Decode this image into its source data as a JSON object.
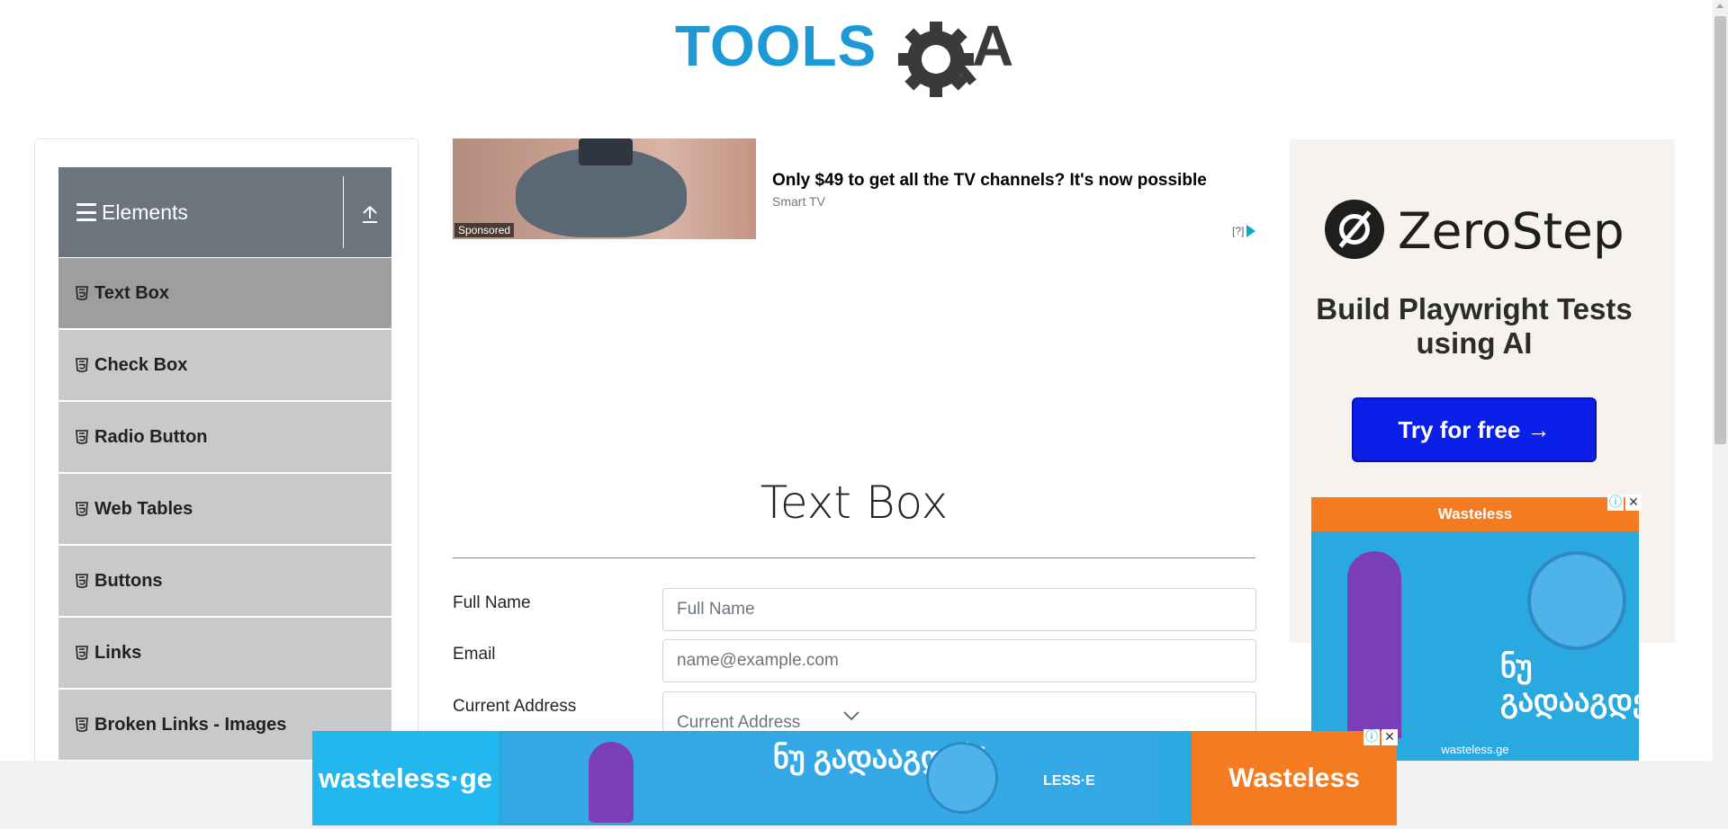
{
  "header": {
    "logo_text": "TOOLSQA",
    "logo_colors": {
      "tools": "#1b9ad6",
      "qa": "#3a3a3a"
    }
  },
  "sidebar": {
    "group_title": "Elements",
    "items": [
      {
        "label": "Text Box",
        "active": true
      },
      {
        "label": "Check Box",
        "active": false
      },
      {
        "label": "Radio Button",
        "active": false
      },
      {
        "label": "Web Tables",
        "active": false
      },
      {
        "label": "Buttons",
        "active": false
      },
      {
        "label": "Links",
        "active": false
      },
      {
        "label": "Broken Links - Images",
        "active": false
      }
    ]
  },
  "ad_top": {
    "title": "Only $49 to get all the TV channels? It's now possible",
    "source": "Smart TV",
    "sponsored": "Sponsored",
    "info": "[?]"
  },
  "main": {
    "page_title": "Text Box",
    "form": {
      "full_name": {
        "label": "Full Name",
        "placeholder": "Full Name"
      },
      "email": {
        "label": "Email",
        "placeholder": "name@example.com"
      },
      "current_address": {
        "label": "Current Address",
        "placeholder": "Current Address"
      }
    }
  },
  "right_ad": {
    "brand": "ZeroStep",
    "tagline": "Build Playwright Tests using AI",
    "cta": "Try for free →",
    "cta_color": "#0a1fe8"
  },
  "wasteless_ad": {
    "brand": "Wasteless",
    "georgian_text": "ნუ გადააგდებ!",
    "footer": "wasteless.ge",
    "partner": "LESS·E"
  },
  "bottom_banner": {
    "left_text": "wasteless·ge",
    "georgian_text": "ნუ გადააგდებ!",
    "partner": "LESS·E",
    "right_text": "Wasteless"
  },
  "colors": {
    "sidebar_header": "#6c757d",
    "menu_item": "#c9c9c9",
    "menu_item_active": "#9e9e9e",
    "wasteless_orange": "#f47b1f",
    "wasteless_blue": "#2aa8e0"
  }
}
